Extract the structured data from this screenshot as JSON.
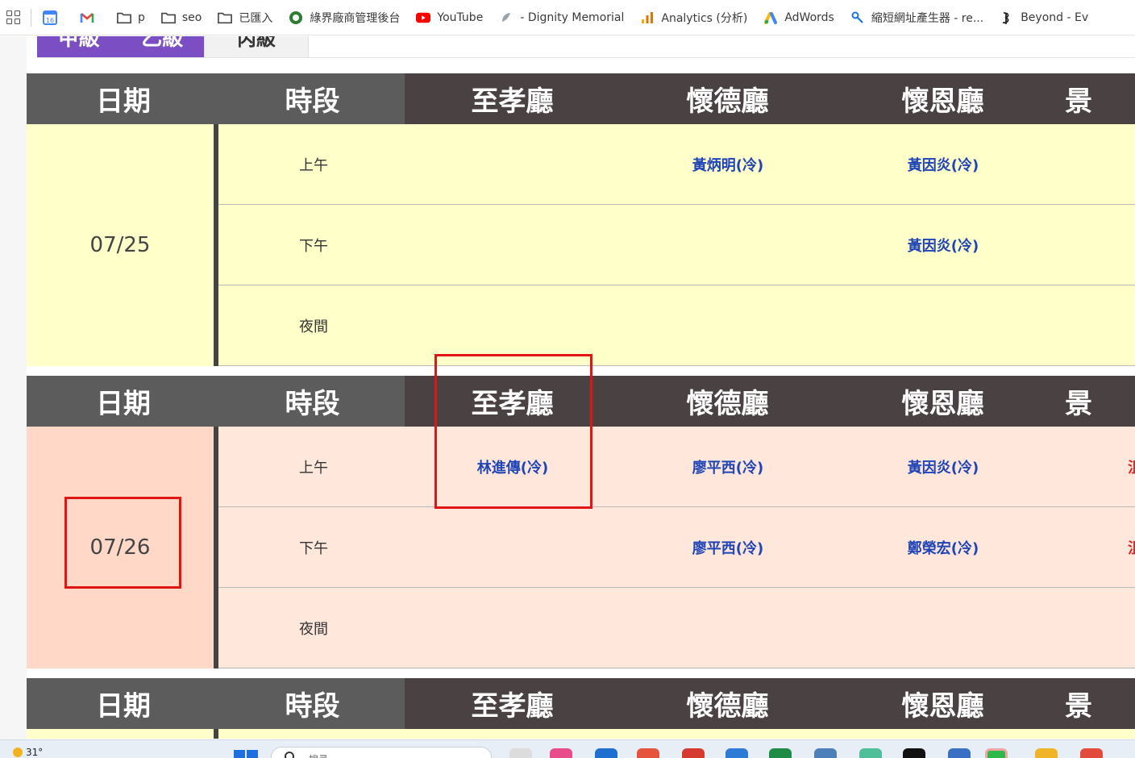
{
  "bookmarks": {
    "items": [
      {
        "label": "",
        "icon": "calendar-icon",
        "badge": "16"
      },
      {
        "label": "",
        "icon": "gmail-icon",
        "badge": "M"
      },
      {
        "label": "p",
        "icon": "folder-icon"
      },
      {
        "label": "seo",
        "icon": "folder-icon"
      },
      {
        "label": "已匯入",
        "icon": "folder-icon"
      },
      {
        "label": "綠界廠商管理後台",
        "icon": "ecpay-icon"
      },
      {
        "label": "YouTube",
        "icon": "youtube-icon"
      },
      {
        "label": "- Dignity Memorial",
        "icon": "dignity-icon"
      },
      {
        "label": "Analytics (分析)",
        "icon": "analytics-icon"
      },
      {
        "label": "AdWords",
        "icon": "adwords-icon"
      },
      {
        "label": "縮短網址產生器 - re...",
        "icon": "link-icon"
      },
      {
        "label": "Beyond - Ev",
        "icon": "beyond-icon"
      }
    ]
  },
  "tabs": {
    "purple": [
      "甲級",
      "乙級"
    ],
    "grey": "丙級"
  },
  "table_headers": [
    "日期",
    "時段",
    "至孝廳",
    "懷德廳",
    "懷恩廳",
    "景"
  ],
  "periods": [
    "上午",
    "下午",
    "夜間"
  ],
  "schedule": [
    {
      "date": "07/25",
      "theme": "yellow",
      "rows": [
        {
          "period": "上午",
          "hall1": "",
          "hall2": "黃炳明(冷)",
          "hall3": "黃因炎(冷)",
          "hall4": ""
        },
        {
          "period": "下午",
          "hall1": "",
          "hall2": "",
          "hall3": "黃因炎(冷)",
          "hall4": ""
        },
        {
          "period": "夜間",
          "hall1": "",
          "hall2": "",
          "hall3": "",
          "hall4": ""
        }
      ]
    },
    {
      "date": "07/26",
      "theme": "pink",
      "rows": [
        {
          "period": "上午",
          "hall1": "林進傳(冷)",
          "hall2": "廖平西(冷)",
          "hall3": "黃因炎(冷)",
          "hall4": "沮"
        },
        {
          "period": "下午",
          "hall1": "",
          "hall2": "廖平西(冷)",
          "hall3": "鄭榮宏(冷)",
          "hall4": "沮"
        },
        {
          "period": "夜間",
          "hall1": "",
          "hall2": "",
          "hall3": "",
          "hall4": ""
        }
      ]
    }
  ],
  "colors": {
    "header_bg": "#4a4142",
    "header_grey": "#5c5c5c",
    "yellow_bg": "#ffffc9",
    "pink_date_bg": "#ffd8c8",
    "pink_bg": "#ffe7dc",
    "name_link": "#1f44b6",
    "annotation": "#e21515",
    "tab_purple": "#7b4fc3"
  },
  "taskbar": {
    "temperature": "31°",
    "search_placeholder": "搜尋"
  }
}
